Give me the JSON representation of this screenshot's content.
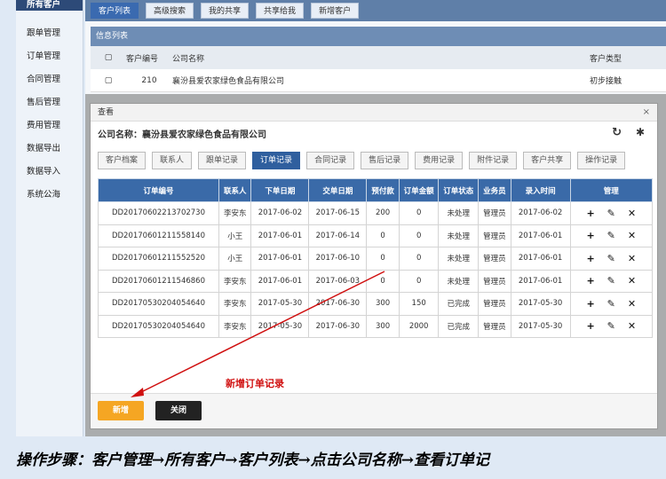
{
  "sidebar": {
    "items": [
      {
        "label": "所有客户"
      },
      {
        "label": "跟单管理"
      },
      {
        "label": "订单管理"
      },
      {
        "label": "合同管理"
      },
      {
        "label": "售后管理"
      },
      {
        "label": "费用管理"
      },
      {
        "label": "数据导出"
      },
      {
        "label": "数据导入"
      },
      {
        "label": "系统公海"
      }
    ]
  },
  "bg": {
    "tabs": [
      "客户列表",
      "高级搜索",
      "我的共享",
      "共享给我",
      "新增客户"
    ],
    "info_title": "信息列表",
    "headers": [
      "客户编号",
      "公司名称",
      "客户类型"
    ],
    "row": {
      "id": "210",
      "company": "襄汾县爱农家绿色食品有限公司",
      "type": "初步接触"
    }
  },
  "modal": {
    "title": "查看",
    "close": "×",
    "company_label": "公司名称：襄汾县爱农家绿色食品有限公司",
    "tabs": [
      "客户档案",
      "联系人",
      "跟单记录",
      "订单记录",
      "合同记录",
      "售后记录",
      "费用记录",
      "附件记录",
      "客户共享",
      "操作记录"
    ],
    "active_tab": 3,
    "columns": [
      "订单编号",
      "联系人",
      "下单日期",
      "交单日期",
      "预付款",
      "订单金额",
      "订单状态",
      "业务员",
      "录入时间",
      "管理"
    ],
    "rows": [
      [
        "DD20170602213702730",
        "李安东",
        "2017-06-02",
        "2017-06-15",
        "200",
        "0",
        "未处理",
        "管理员",
        "2017-06-02"
      ],
      [
        "DD20170601211558140",
        "小王",
        "2017-06-01",
        "2017-06-14",
        "0",
        "0",
        "未处理",
        "管理员",
        "2017-06-01"
      ],
      [
        "DD20170601211552520",
        "小王",
        "2017-06-01",
        "2017-06-10",
        "0",
        "0",
        "未处理",
        "管理员",
        "2017-06-01"
      ],
      [
        "DD20170601211546860",
        "李安东",
        "2017-06-01",
        "2017-06-03",
        "0",
        "0",
        "未处理",
        "管理员",
        "2017-06-01"
      ],
      [
        "DD20170530204054640",
        "李安东",
        "2017-05-30",
        "2017-06-30",
        "300",
        "150",
        "已完成",
        "管理员",
        "2017-05-30"
      ],
      [
        "DD20170530204054640",
        "李安东",
        "2017-05-30",
        "2017-06-30",
        "300",
        "2000",
        "已完成",
        "管理员",
        "2017-05-30"
      ]
    ],
    "actions": [
      "+",
      "✎",
      "✕"
    ],
    "btn_new": "新增",
    "btn_close": "关闭"
  },
  "annotation": "新增订单记录",
  "bottom_note": "操作步骤：客户管理→所有客户→客户列表→点击公司名称→查看订单记",
  "colors": {
    "accent": "#2f5f9e",
    "new_button": "#f5a623",
    "annotation": "#d01010"
  }
}
